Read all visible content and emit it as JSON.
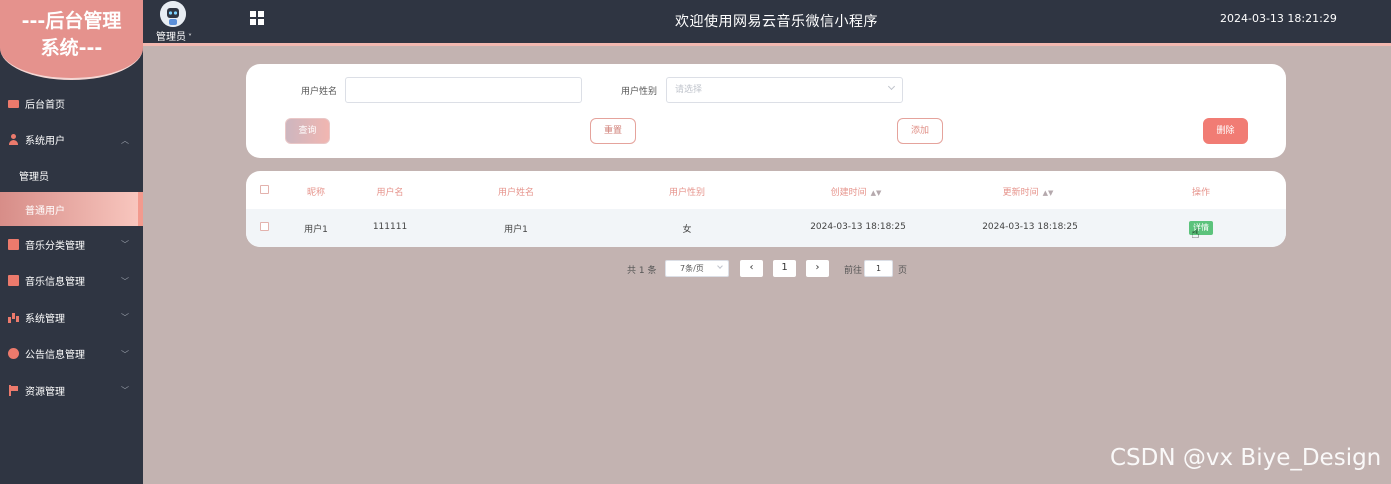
{
  "sidebar": {
    "logo_line1": "---后台管理",
    "logo_line2": "系统---",
    "items": [
      {
        "label": "后台首页"
      },
      {
        "label": "系统用户"
      },
      {
        "label": "管理员"
      },
      {
        "label": "普通用户"
      },
      {
        "label": "音乐分类管理"
      },
      {
        "label": "音乐信息管理"
      },
      {
        "label": "系统管理"
      },
      {
        "label": "公告信息管理"
      },
      {
        "label": "资源管理"
      }
    ]
  },
  "header": {
    "user_role": "管理员",
    "title": "欢迎使用网易云音乐微信小程序",
    "datetime": "2024-03-13 18:21:29"
  },
  "search": {
    "name_label": "用户姓名",
    "name_value": "",
    "gender_label": "用户性别",
    "gender_placeholder": "请选择",
    "query_btn": "查询",
    "reset_btn": "重置",
    "add_btn": "添加",
    "delete_btn": "删除"
  },
  "table": {
    "headers": [
      "昵称",
      "用户名",
      "用户姓名",
      "用户性别",
      "创建时间",
      "更新时间",
      "操作"
    ],
    "rows": [
      {
        "nickname": "用户1",
        "username": "111111",
        "name": "用户1",
        "gender": "女",
        "created": "2024-03-13 18:18:25",
        "updated": "2024-03-13 18:18:25",
        "action": "详情"
      }
    ]
  },
  "pagination": {
    "total": "共 1 条",
    "page_size": "7条/页",
    "current": "1",
    "goto_prefix": "前往",
    "goto_value": "1",
    "goto_suffix": "页",
    "prev": "‹",
    "next": "›"
  },
  "watermark": "CSDN @vx Biye_Design",
  "colors": {
    "sidebar_bg": "#2f3542",
    "accent": "#e5928d",
    "content_bg": "#c3b3b1",
    "delete": "#f17c74",
    "detail": "#5cc37c"
  }
}
